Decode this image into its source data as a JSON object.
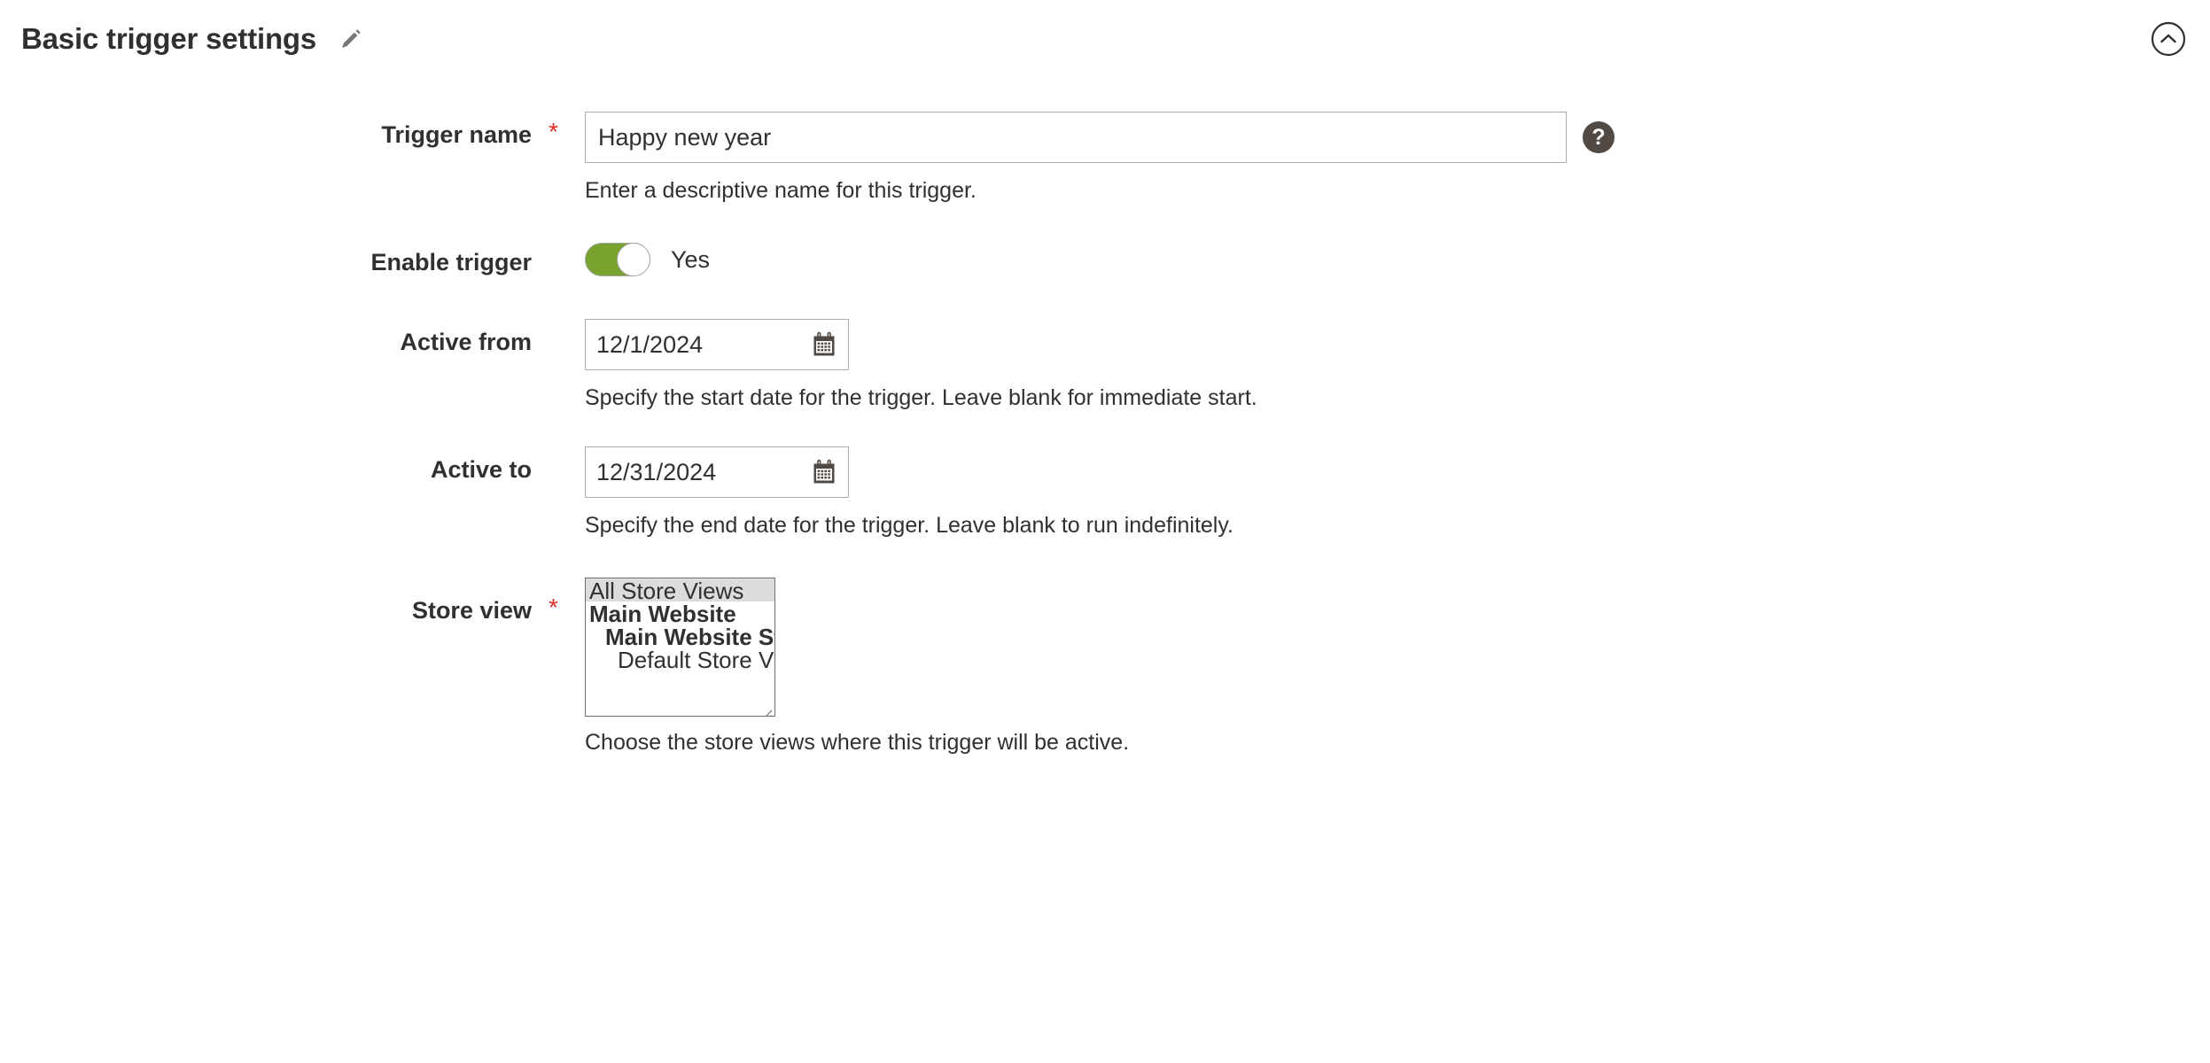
{
  "header": {
    "title": "Basic trigger settings",
    "edit_icon": "pencil-icon",
    "collapse_icon": "chevron-up-circle-icon"
  },
  "colors": {
    "toggle_on": "#79a22e",
    "required_star": "#e02b27",
    "help_icon_bg": "#514943",
    "selected_option_bg": "#dcdcdc",
    "input_border": "#adadad",
    "text": "#303030"
  },
  "fields": {
    "trigger_name": {
      "label": "Trigger name",
      "required": "*",
      "value": "Happy new year",
      "placeholder": "",
      "help_icon": "question-mark-icon",
      "note": "Enter a descriptive name for this trigger."
    },
    "enable_trigger": {
      "label": "Enable trigger",
      "toggle_state": "Yes",
      "toggle_on": true
    },
    "active_from": {
      "label": "Active from",
      "value": "12/1/2024",
      "placeholder": "",
      "calendar_icon": "calendar-icon",
      "note": "Specify the start date for the trigger. Leave blank for immediate start."
    },
    "active_to": {
      "label": "Active to",
      "value": "12/31/2024",
      "placeholder": "",
      "calendar_icon": "calendar-icon",
      "note": "Specify the end date for the trigger. Leave blank to run indefinitely."
    },
    "store_view": {
      "label": "Store view",
      "required": "*",
      "note": "Choose the store views where this trigger will be active.",
      "options": [
        {
          "label": "All Store Views",
          "level": 0,
          "selected": true
        },
        {
          "label": "Main Website",
          "level": 1,
          "selected": false
        },
        {
          "label": "Main Website Store",
          "level": 2,
          "selected": false
        },
        {
          "label": "Default Store View",
          "level": 3,
          "selected": false
        }
      ]
    }
  }
}
